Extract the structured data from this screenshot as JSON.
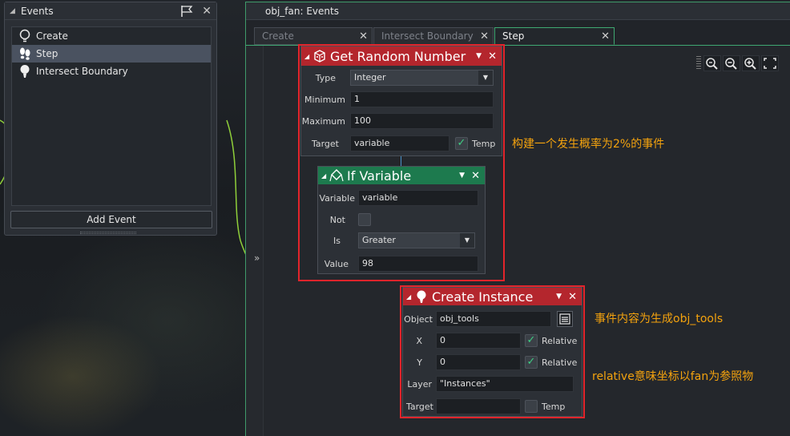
{
  "events_panel": {
    "title": "Events",
    "items": [
      {
        "label": "Create",
        "icon": "lightbulb-icon"
      },
      {
        "label": "Step",
        "icon": "footsteps-icon"
      },
      {
        "label": "Intersect Boundary",
        "icon": "bulb-pin-icon"
      }
    ],
    "selected_index": 1,
    "add_event_label": "Add Event"
  },
  "editor": {
    "title": "obj_fan: Events",
    "tabs": [
      {
        "label": "Create",
        "active": false
      },
      {
        "label": "Intersect Boundary",
        "active": false
      },
      {
        "label": "Step",
        "active": true
      }
    ],
    "expand_label": "»"
  },
  "get_random_number": {
    "name": "Get Random Number",
    "type_label": "Type",
    "type_value": "Integer",
    "min_label": "Minimum",
    "min_value": "1",
    "max_label": "Maximum",
    "max_value": "100",
    "target_label": "Target",
    "target_value": "variable",
    "temp_label": "Temp",
    "temp_checked": true
  },
  "if_variable": {
    "name": "If Variable",
    "variable_label": "Variable",
    "variable_value": "variable",
    "not_label": "Not",
    "not_checked": false,
    "is_label": "Is",
    "is_value": "Greater",
    "value_label": "Value",
    "value_value": "98"
  },
  "create_instance": {
    "name": "Create Instance",
    "object_label": "Object",
    "object_value": "obj_tools",
    "x_label": "X",
    "x_value": "0",
    "x_relative_label": "Relative",
    "x_relative_checked": true,
    "y_label": "Y",
    "y_value": "0",
    "y_relative_label": "Relative",
    "y_relative_checked": true,
    "layer_label": "Layer",
    "layer_value": "\"Instances\"",
    "target_label": "Target",
    "target_value": "",
    "temp_label": "Temp",
    "temp_checked": false
  },
  "annotations": {
    "note1": "构建一个发生概率为2%的事件",
    "note2": "事件内容为生成obj_tools",
    "note3": "relative意味坐标以fan为参照物"
  },
  "colors": {
    "highlight_red": "#e3242b",
    "annotation_orange": "#f3a20e",
    "action_red": "#b4262d",
    "condition_green": "#1d7a4e",
    "window_accent": "#3fa872"
  }
}
